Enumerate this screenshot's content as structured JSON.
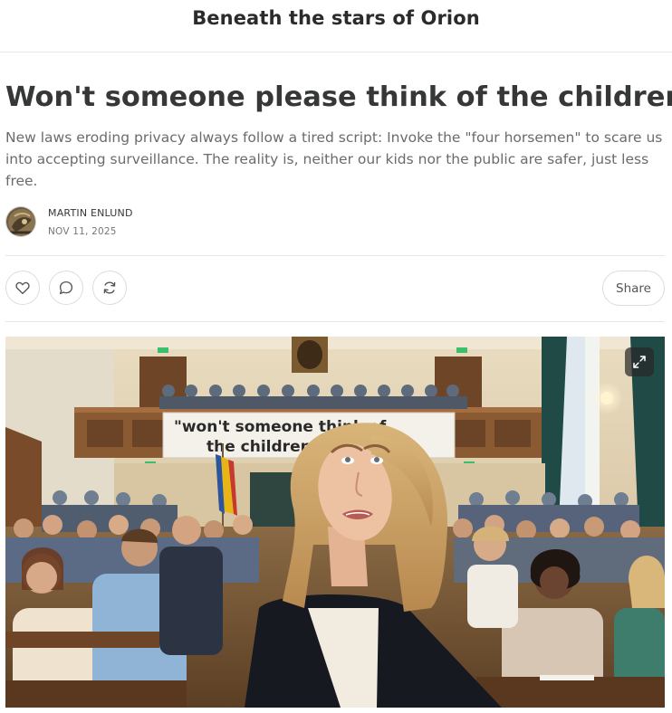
{
  "header": {
    "publication_title": "Beneath the stars of Orion"
  },
  "post": {
    "title": "Won't someone please think of the children?",
    "subtitle": "New laws eroding privacy always follow a tired script: Invoke the \"four horsemen\" to scare us into accepting surveillance. The reality is, neither our kids nor the public are safer, just less free.",
    "author": "MARTIN ENLUND",
    "date": "NOV 11, 2025"
  },
  "actions": {
    "like_icon": "heart-icon",
    "comment_icon": "speech-bubble-icon",
    "restack_icon": "refresh-icon",
    "share_label": "Share"
  },
  "hero_image": {
    "banner_line1": "\"won't someone think of",
    "banner_line2": "the children!\"",
    "expand_icon": "expand-icon"
  },
  "colors": {
    "text": "#363737",
    "muted": "#6b6b6b",
    "border": "#e6e6e6"
  }
}
